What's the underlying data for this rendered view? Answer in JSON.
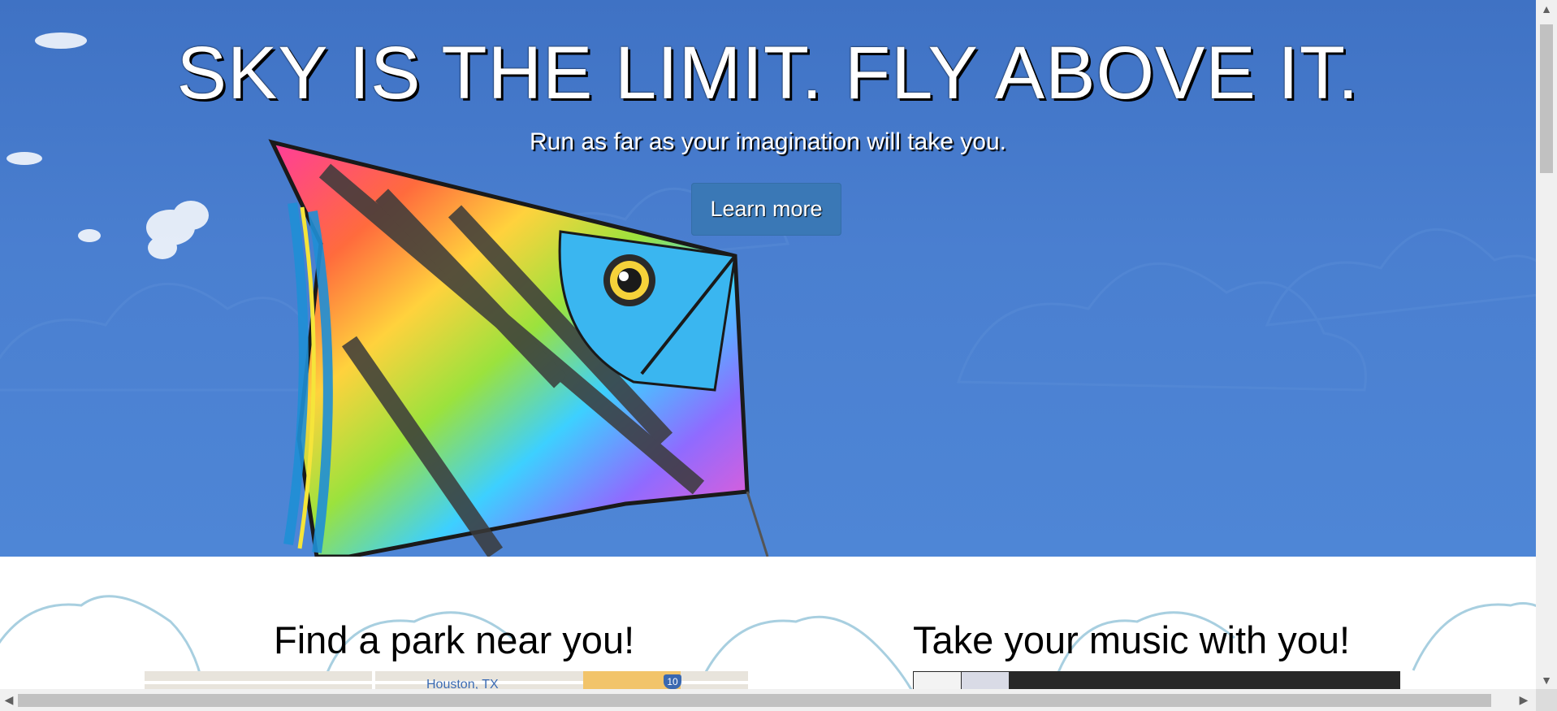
{
  "hero": {
    "title": "SKY IS THE LIMIT. FLY ABOVE IT.",
    "subtitle": "Run as far as your imagination will take you.",
    "button_label": "Learn more",
    "background_color": "#4a7fd0"
  },
  "sections": {
    "left_title": "Find a park near you!",
    "right_title": "Take your music with you!",
    "map_label": "Houston, TX",
    "map_shield": "10"
  },
  "colors": {
    "button": "#3a78b6",
    "cloud_outline": "#a8cfe0",
    "music_player": "#282828"
  },
  "icons": {
    "scroll_up": "▲",
    "scroll_down": "▼",
    "scroll_left": "◀",
    "scroll_right": "▶"
  }
}
